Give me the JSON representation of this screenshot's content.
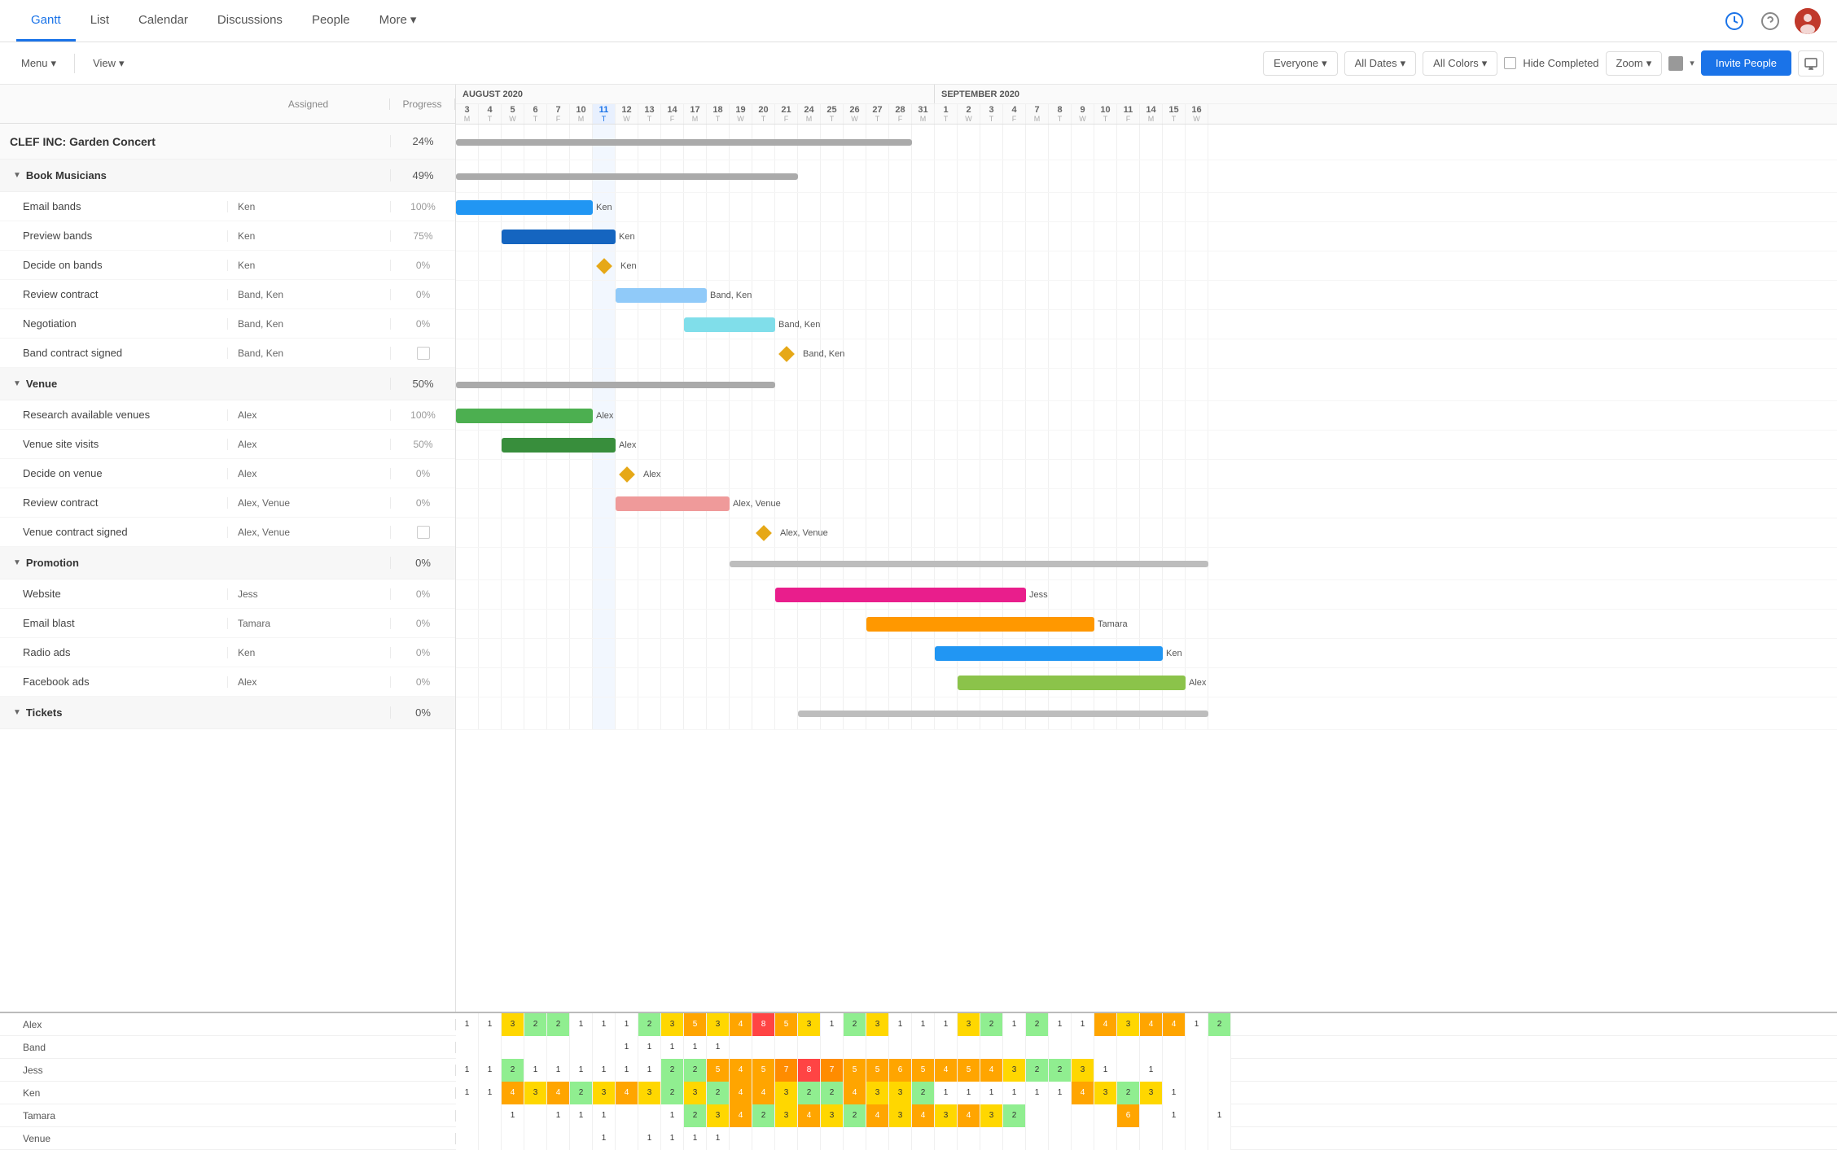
{
  "nav": {
    "tabs": [
      {
        "id": "gantt",
        "label": "Gantt",
        "active": true
      },
      {
        "id": "list",
        "label": "List",
        "active": false
      },
      {
        "id": "calendar",
        "label": "Calendar",
        "active": false
      },
      {
        "id": "discussions",
        "label": "Discussions",
        "active": false
      },
      {
        "id": "people",
        "label": "People",
        "active": false
      },
      {
        "id": "more",
        "label": "More",
        "active": false
      }
    ]
  },
  "toolbar": {
    "menu_label": "Menu",
    "view_label": "View",
    "everyone_label": "Everyone",
    "all_dates_label": "All Dates",
    "all_colors_label": "All Colors",
    "hide_completed_label": "Hide Completed",
    "zoom_label": "Zoom",
    "invite_label": "Invite People"
  },
  "project": {
    "name": "CLEF INC: Garden Concert",
    "progress": "24%"
  },
  "groups": [
    {
      "name": "Book Musicians",
      "progress": "49%",
      "tasks": [
        {
          "name": "Email bands",
          "assigned": "Ken",
          "progress": "100%"
        },
        {
          "name": "Preview bands",
          "assigned": "Ken",
          "progress": "75%"
        },
        {
          "name": "Decide on bands",
          "assigned": "Ken",
          "progress": "0%",
          "isDiamond": true
        },
        {
          "name": "Review contract",
          "assigned": "Band, Ken",
          "progress": "0%"
        },
        {
          "name": "Negotiation",
          "assigned": "Band, Ken",
          "progress": "0%"
        },
        {
          "name": "Band contract signed",
          "assigned": "Band, Ken",
          "progress": "",
          "isCheck": true
        }
      ]
    },
    {
      "name": "Venue",
      "progress": "50%",
      "tasks": [
        {
          "name": "Research available venues",
          "assigned": "Alex",
          "progress": "100%"
        },
        {
          "name": "Venue site visits",
          "assigned": "Alex",
          "progress": "50%"
        },
        {
          "name": "Decide on venue",
          "assigned": "Alex",
          "progress": "0%",
          "isDiamond": true
        },
        {
          "name": "Review contract",
          "assigned": "Alex, Venue",
          "progress": "0%"
        },
        {
          "name": "Venue contract signed",
          "assigned": "Alex, Venue",
          "progress": "",
          "isCheck": true
        }
      ]
    },
    {
      "name": "Promotion",
      "progress": "0%",
      "tasks": [
        {
          "name": "Website",
          "assigned": "Jess",
          "progress": "0%"
        },
        {
          "name": "Email blast",
          "assigned": "Tamara",
          "progress": "0%"
        },
        {
          "name": "Radio ads",
          "assigned": "Ken",
          "progress": "0%"
        },
        {
          "name": "Facebook ads",
          "assigned": "Alex",
          "progress": "0%"
        }
      ]
    },
    {
      "name": "Tickets",
      "progress": "0%",
      "tasks": []
    }
  ],
  "calendar": {
    "august_label": "AUGUST 2020",
    "september_label": "SEPTEMBER 2",
    "days_aug": [
      {
        "num": "3",
        "letter": "M"
      },
      {
        "num": "4",
        "letter": "T"
      },
      {
        "num": "5",
        "letter": "W"
      },
      {
        "num": "6",
        "letter": "T"
      },
      {
        "num": "7",
        "letter": "F"
      },
      {
        "num": "10",
        "letter": "M"
      },
      {
        "num": "11",
        "letter": "T",
        "today": true
      },
      {
        "num": "12",
        "letter": "W"
      },
      {
        "num": "13",
        "letter": "T"
      },
      {
        "num": "14",
        "letter": "F"
      },
      {
        "num": "17",
        "letter": "M"
      },
      {
        "num": "18",
        "letter": "T"
      },
      {
        "num": "19",
        "letter": "W"
      },
      {
        "num": "20",
        "letter": "T"
      },
      {
        "num": "21",
        "letter": "F"
      },
      {
        "num": "24",
        "letter": "M"
      },
      {
        "num": "25",
        "letter": "T"
      },
      {
        "num": "26",
        "letter": "W"
      },
      {
        "num": "27",
        "letter": "T"
      },
      {
        "num": "28",
        "letter": "F"
      },
      {
        "num": "31",
        "letter": "M"
      }
    ],
    "days_sep": [
      {
        "num": "1",
        "letter": "T"
      },
      {
        "num": "2",
        "letter": "W"
      },
      {
        "num": "3",
        "letter": "T"
      },
      {
        "num": "4",
        "letter": "F"
      },
      {
        "num": "7",
        "letter": "M"
      },
      {
        "num": "8",
        "letter": "T"
      },
      {
        "num": "9",
        "letter": "W"
      },
      {
        "num": "10",
        "letter": "T"
      },
      {
        "num": "11",
        "letter": "F"
      },
      {
        "num": "14",
        "letter": "M"
      },
      {
        "num": "15",
        "letter": "T"
      },
      {
        "num": "16",
        "letter": "W"
      }
    ]
  },
  "resources": [
    {
      "name": "Alex",
      "cells": [
        {
          "val": "1",
          "color": "#fff"
        },
        {
          "val": "1",
          "color": "#fff"
        },
        {
          "val": "3",
          "color": "#ffd700"
        },
        {
          "val": "2",
          "color": "#90ee90"
        },
        {
          "val": "2",
          "color": "#90ee90"
        },
        {
          "val": "1",
          "color": "#fff"
        },
        {
          "val": "1",
          "color": "#fff"
        },
        {
          "val": "1",
          "color": "#fff"
        },
        {
          "val": "2",
          "color": "#90ee90"
        },
        {
          "val": "3",
          "color": "#ffd700"
        },
        {
          "val": "5",
          "color": "#ffa500"
        },
        {
          "val": "3",
          "color": "#ffd700"
        },
        {
          "val": "4",
          "color": "#ffa500"
        },
        {
          "val": "8",
          "color": "#ff4444"
        },
        {
          "val": "5",
          "color": "#ffa500"
        },
        {
          "val": "3",
          "color": "#ffd700"
        },
        {
          "val": "1",
          "color": "#fff"
        },
        {
          "val": "2",
          "color": "#90ee90"
        },
        {
          "val": "3",
          "color": "#ffd700"
        },
        {
          "val": "1",
          "color": "#fff"
        },
        {
          "val": "1",
          "color": "#fff"
        },
        {
          "val": "1",
          "color": "#fff"
        },
        {
          "val": "3",
          "color": "#ffd700"
        },
        {
          "val": "2",
          "color": "#90ee90"
        },
        {
          "val": "1",
          "color": "#fff"
        },
        {
          "val": "2",
          "color": "#90ee90"
        },
        {
          "val": "1",
          "color": "#fff"
        },
        {
          "val": "1",
          "color": "#fff"
        },
        {
          "val": "4",
          "color": "#ffa500"
        },
        {
          "val": "3",
          "color": "#ffd700"
        },
        {
          "val": "4",
          "color": "#ffa500"
        },
        {
          "val": "4",
          "color": "#ffa500"
        },
        {
          "val": "1",
          "color": "#fff"
        },
        {
          "val": "2",
          "color": "#90ee90"
        }
      ]
    },
    {
      "name": "Band",
      "cells": [
        {
          "val": "",
          "color": "#fff"
        },
        {
          "val": "",
          "color": "#fff"
        },
        {
          "val": "",
          "color": "#fff"
        },
        {
          "val": "",
          "color": "#fff"
        },
        {
          "val": "",
          "color": "#fff"
        },
        {
          "val": "",
          "color": "#fff"
        },
        {
          "val": "",
          "color": "#fff"
        },
        {
          "val": "1",
          "color": "#fff"
        },
        {
          "val": "1",
          "color": "#fff"
        },
        {
          "val": "1",
          "color": "#fff"
        },
        {
          "val": "1",
          "color": "#fff"
        },
        {
          "val": "1",
          "color": "#fff"
        },
        {
          "val": "",
          "color": "#fff"
        },
        {
          "val": "",
          "color": "#fff"
        },
        {
          "val": "",
          "color": "#fff"
        },
        {
          "val": "",
          "color": "#fff"
        },
        {
          "val": "",
          "color": "#fff"
        },
        {
          "val": "",
          "color": "#fff"
        },
        {
          "val": "",
          "color": "#fff"
        },
        {
          "val": "",
          "color": "#fff"
        },
        {
          "val": "",
          "color": "#fff"
        },
        {
          "val": "",
          "color": "#fff"
        },
        {
          "val": "",
          "color": "#fff"
        },
        {
          "val": "",
          "color": "#fff"
        },
        {
          "val": "",
          "color": "#fff"
        },
        {
          "val": "",
          "color": "#fff"
        },
        {
          "val": "",
          "color": "#fff"
        },
        {
          "val": "",
          "color": "#fff"
        },
        {
          "val": "",
          "color": "#fff"
        },
        {
          "val": "",
          "color": "#fff"
        },
        {
          "val": "",
          "color": "#fff"
        },
        {
          "val": "",
          "color": "#fff"
        },
        {
          "val": "",
          "color": "#fff"
        },
        {
          "val": "",
          "color": "#fff"
        }
      ]
    },
    {
      "name": "Jess",
      "cells": [
        {
          "val": "1",
          "color": "#fff"
        },
        {
          "val": "1",
          "color": "#fff"
        },
        {
          "val": "2",
          "color": "#90ee90"
        },
        {
          "val": "1",
          "color": "#fff"
        },
        {
          "val": "1",
          "color": "#fff"
        },
        {
          "val": "1",
          "color": "#fff"
        },
        {
          "val": "1",
          "color": "#fff"
        },
        {
          "val": "1",
          "color": "#fff"
        },
        {
          "val": "1",
          "color": "#fff"
        },
        {
          "val": "2",
          "color": "#90ee90"
        },
        {
          "val": "2",
          "color": "#90ee90"
        },
        {
          "val": "5",
          "color": "#ffa500"
        },
        {
          "val": "4",
          "color": "#ffa500"
        },
        {
          "val": "5",
          "color": "#ffa500"
        },
        {
          "val": "7",
          "color": "#ff8c00"
        },
        {
          "val": "8",
          "color": "#ff4444"
        },
        {
          "val": "7",
          "color": "#ff8c00"
        },
        {
          "val": "5",
          "color": "#ffa500"
        },
        {
          "val": "5",
          "color": "#ffa500"
        },
        {
          "val": "6",
          "color": "#ffa500"
        },
        {
          "val": "5",
          "color": "#ffa500"
        },
        {
          "val": "4",
          "color": "#ffa500"
        },
        {
          "val": "5",
          "color": "#ffa500"
        },
        {
          "val": "4",
          "color": "#ffa500"
        },
        {
          "val": "3",
          "color": "#ffd700"
        },
        {
          "val": "2",
          "color": "#90ee90"
        },
        {
          "val": "2",
          "color": "#90ee90"
        },
        {
          "val": "3",
          "color": "#ffd700"
        },
        {
          "val": "1",
          "color": "#fff"
        },
        {
          "val": "",
          "color": "#fff"
        },
        {
          "val": "1",
          "color": "#fff"
        },
        {
          "val": "",
          "color": "#fff"
        },
        {
          "val": "",
          "color": "#fff"
        },
        {
          "val": "",
          "color": "#fff"
        }
      ]
    },
    {
      "name": "Ken",
      "cells": [
        {
          "val": "1",
          "color": "#fff"
        },
        {
          "val": "1",
          "color": "#fff"
        },
        {
          "val": "4",
          "color": "#ffa500"
        },
        {
          "val": "3",
          "color": "#ffd700"
        },
        {
          "val": "4",
          "color": "#ffa500"
        },
        {
          "val": "2",
          "color": "#90ee90"
        },
        {
          "val": "3",
          "color": "#ffd700"
        },
        {
          "val": "4",
          "color": "#ffa500"
        },
        {
          "val": "3",
          "color": "#ffd700"
        },
        {
          "val": "2",
          "color": "#90ee90"
        },
        {
          "val": "3",
          "color": "#ffd700"
        },
        {
          "val": "2",
          "color": "#90ee90"
        },
        {
          "val": "4",
          "color": "#ffa500"
        },
        {
          "val": "4",
          "color": "#ffa500"
        },
        {
          "val": "3",
          "color": "#ffd700"
        },
        {
          "val": "2",
          "color": "#90ee90"
        },
        {
          "val": "2",
          "color": "#90ee90"
        },
        {
          "val": "4",
          "color": "#ffa500"
        },
        {
          "val": "3",
          "color": "#ffd700"
        },
        {
          "val": "3",
          "color": "#ffd700"
        },
        {
          "val": "2",
          "color": "#90ee90"
        },
        {
          "val": "1",
          "color": "#fff"
        },
        {
          "val": "1",
          "color": "#fff"
        },
        {
          "val": "1",
          "color": "#fff"
        },
        {
          "val": "1",
          "color": "#fff"
        },
        {
          "val": "1",
          "color": "#fff"
        },
        {
          "val": "1",
          "color": "#fff"
        },
        {
          "val": "4",
          "color": "#ffa500"
        },
        {
          "val": "3",
          "color": "#ffd700"
        },
        {
          "val": "2",
          "color": "#90ee90"
        },
        {
          "val": "3",
          "color": "#ffd700"
        },
        {
          "val": "1",
          "color": "#fff"
        },
        {
          "val": "",
          "color": "#fff"
        },
        {
          "val": "",
          "color": "#fff"
        }
      ]
    },
    {
      "name": "Tamara",
      "cells": [
        {
          "val": "",
          "color": "#fff"
        },
        {
          "val": "",
          "color": "#fff"
        },
        {
          "val": "1",
          "color": "#fff"
        },
        {
          "val": "",
          "color": "#fff"
        },
        {
          "val": "1",
          "color": "#fff"
        },
        {
          "val": "1",
          "color": "#fff"
        },
        {
          "val": "1",
          "color": "#fff"
        },
        {
          "val": "",
          "color": "#fff"
        },
        {
          "val": "",
          "color": "#fff"
        },
        {
          "val": "1",
          "color": "#fff"
        },
        {
          "val": "2",
          "color": "#90ee90"
        },
        {
          "val": "3",
          "color": "#ffd700"
        },
        {
          "val": "4",
          "color": "#ffa500"
        },
        {
          "val": "2",
          "color": "#90ee90"
        },
        {
          "val": "3",
          "color": "#ffd700"
        },
        {
          "val": "4",
          "color": "#ffa500"
        },
        {
          "val": "3",
          "color": "#ffd700"
        },
        {
          "val": "2",
          "color": "#90ee90"
        },
        {
          "val": "4",
          "color": "#ffa500"
        },
        {
          "val": "3",
          "color": "#ffd700"
        },
        {
          "val": "4",
          "color": "#ffa500"
        },
        {
          "val": "3",
          "color": "#ffd700"
        },
        {
          "val": "4",
          "color": "#ffa500"
        },
        {
          "val": "3",
          "color": "#ffd700"
        },
        {
          "val": "2",
          "color": "#90ee90"
        },
        {
          "val": "",
          "color": "#fff"
        },
        {
          "val": "",
          "color": "#fff"
        },
        {
          "val": "",
          "color": "#fff"
        },
        {
          "val": "",
          "color": "#fff"
        },
        {
          "val": "6",
          "color": "#ffa500"
        },
        {
          "val": "",
          "color": "#fff"
        },
        {
          "val": "1",
          "color": "#fff"
        },
        {
          "val": "",
          "color": "#fff"
        },
        {
          "val": "1",
          "color": "#fff"
        }
      ]
    },
    {
      "name": "Venue",
      "cells": [
        {
          "val": "",
          "color": "#fff"
        },
        {
          "val": "",
          "color": "#fff"
        },
        {
          "val": "",
          "color": "#fff"
        },
        {
          "val": "",
          "color": "#fff"
        },
        {
          "val": "",
          "color": "#fff"
        },
        {
          "val": "",
          "color": "#fff"
        },
        {
          "val": "1",
          "color": "#fff"
        },
        {
          "val": "",
          "color": "#fff"
        },
        {
          "val": "1",
          "color": "#fff"
        },
        {
          "val": "1",
          "color": "#fff"
        },
        {
          "val": "1",
          "color": "#fff"
        },
        {
          "val": "1",
          "color": "#fff"
        },
        {
          "val": "",
          "color": "#fff"
        },
        {
          "val": "",
          "color": "#fff"
        },
        {
          "val": "",
          "color": "#fff"
        },
        {
          "val": "",
          "color": "#fff"
        },
        {
          "val": "",
          "color": "#fff"
        },
        {
          "val": "",
          "color": "#fff"
        },
        {
          "val": "",
          "color": "#fff"
        },
        {
          "val": "",
          "color": "#fff"
        },
        {
          "val": "",
          "color": "#fff"
        },
        {
          "val": "",
          "color": "#fff"
        },
        {
          "val": "",
          "color": "#fff"
        },
        {
          "val": "",
          "color": "#fff"
        },
        {
          "val": "",
          "color": "#fff"
        },
        {
          "val": "",
          "color": "#fff"
        },
        {
          "val": "",
          "color": "#fff"
        },
        {
          "val": "",
          "color": "#fff"
        },
        {
          "val": "",
          "color": "#fff"
        },
        {
          "val": "",
          "color": "#fff"
        },
        {
          "val": "",
          "color": "#fff"
        },
        {
          "val": "",
          "color": "#fff"
        },
        {
          "val": "",
          "color": "#fff"
        },
        {
          "val": "",
          "color": "#fff"
        }
      ]
    }
  ]
}
